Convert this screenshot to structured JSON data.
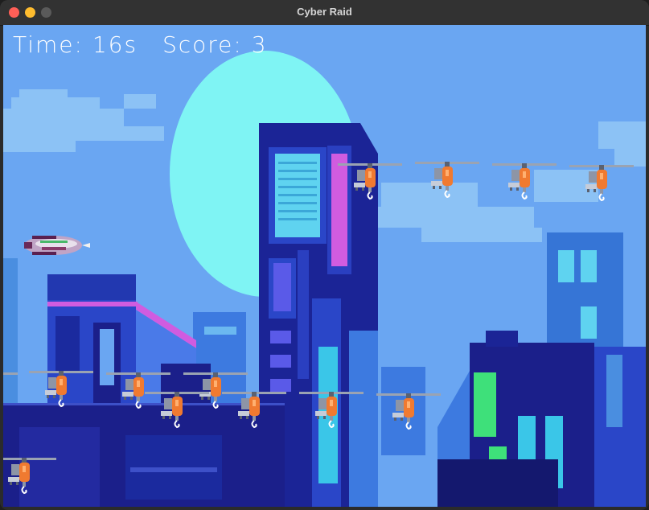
{
  "window": {
    "title": "Cyber Raid"
  },
  "hud": {
    "time_label": "Time: 16s",
    "score_label": "Score: 3"
  },
  "colors": {
    "sky": "#6aa6f2",
    "moon": "#7ff4f4",
    "building_dark": "#1b1f8a",
    "building_mid": "#2a46c8",
    "neon_pink": "#d05ce0",
    "neon_green": "#3ee07a",
    "helicopter_body": "#f07a30"
  },
  "sprites": {
    "player": "spaceship",
    "enemy": "helicopter"
  }
}
